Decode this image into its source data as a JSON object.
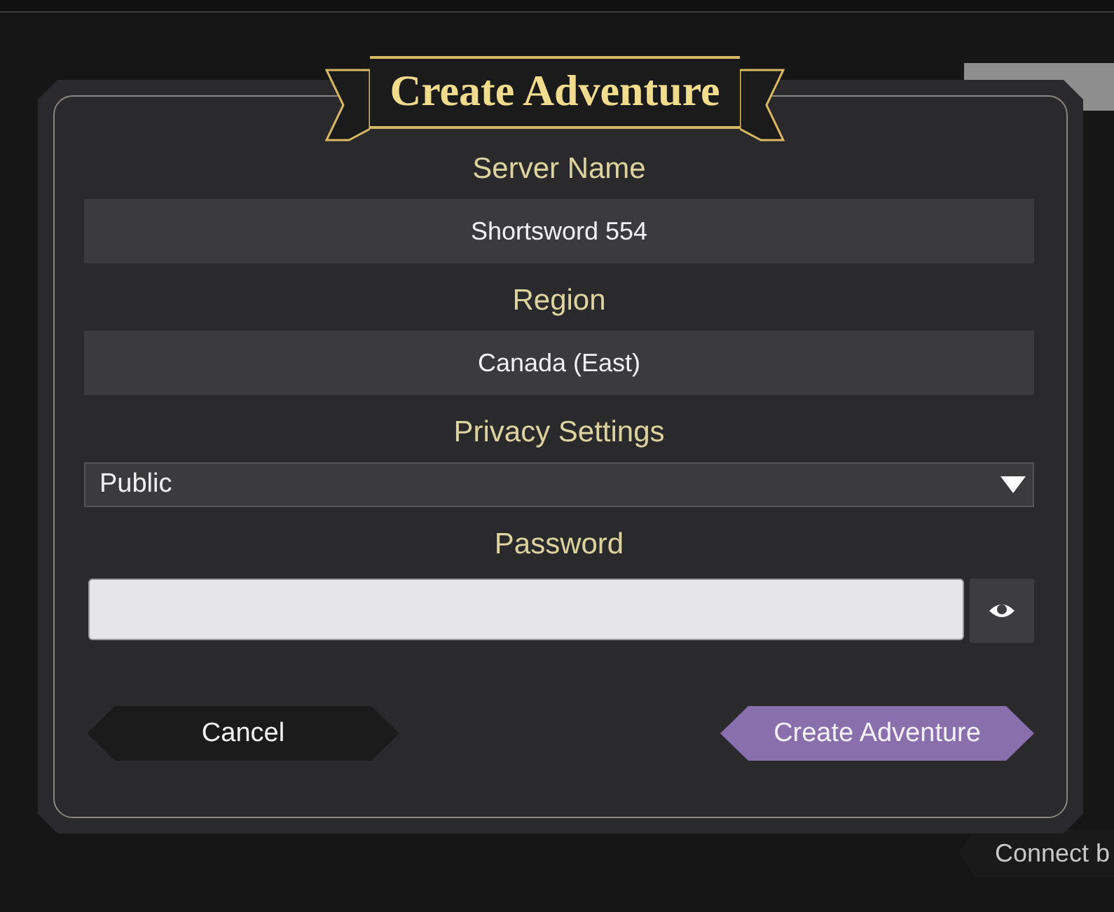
{
  "dialog": {
    "title": "Create Adventure",
    "fields": [
      {
        "kind": "text",
        "label": "Server Name",
        "value": "Shortsword 554"
      },
      {
        "kind": "text",
        "label": "Region",
        "value": "Canada (East)"
      },
      {
        "kind": "select",
        "label": "Privacy Settings",
        "value": "Public"
      },
      {
        "kind": "password",
        "label": "Password"
      }
    ],
    "buttons": [
      {
        "kind": "secondary",
        "label": "Cancel"
      },
      {
        "kind": "primary",
        "label": "Create Adventure"
      }
    ]
  },
  "background": {
    "connect_button": "Connect b"
  }
}
